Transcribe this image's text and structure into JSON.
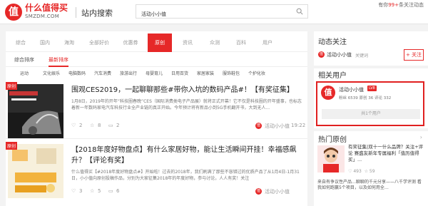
{
  "header": {
    "logo_char": "值",
    "brand": "什么值得买",
    "brand_sub": "SMZDM.COM",
    "search_title": "站内搜索",
    "search_value": "活动小小值",
    "follow_prefix": "有你",
    "follow_count": "99+",
    "follow_suffix": "条关注动态"
  },
  "tabs": [
    "综合",
    "国内",
    "海淘",
    "全部好价",
    "优惠券",
    "原创",
    "资讯",
    "众测",
    "百科",
    "用户"
  ],
  "active_tab": "原创",
  "sort": {
    "label": "综合排序",
    "active": "最新排序"
  },
  "sub_cats": [
    "运动",
    "文化娱乐",
    "电脑数码",
    "汽车消费",
    "旅游出行",
    "母婴育儿",
    "日用百货",
    "家居家装",
    "服饰鞋包",
    "个护化妆"
  ],
  "articles": [
    {
      "badge": "原创",
      "title": "围观CES2019，一起聊聊那些#带你入坑的数码产品#！【有奖征集】",
      "excerpt": "1月8日，2019年的开年“科技圈春晚”CES（国际消费类电子产品展）就将正式开幕！它不仅是科技圈的开年盛事，也标志着新一年数码家电汽车科技行业全产业链的真正开始。今年预计将有新品小到5G手机翻开书，大到无人...",
      "likes": "2",
      "fav": "8",
      "comments": "2",
      "author": "活动小小值",
      "time": "19:22"
    },
    {
      "badge": "原创",
      "title": "【2018年度好物盘点】有什么家居好物，能让生活瞬间开挂！幸福感飙升？【评论有奖】",
      "excerpt": "什么值得买【#2018年度好物盘点#】开始啦！过去的2018年，我们刷满了那些不容错过的优质产品了从1月4日-1月31日，小小值向原创投稿作品，分别为大家征集2018年的年度好物，参与讨论，人人有奖！关注",
      "likes": "3",
      "fav": "5",
      "comments": "6",
      "author": "活动小小值",
      "time": ""
    }
  ],
  "right": {
    "follow_title": "动态关注",
    "follow_user": "活动小小值",
    "follow_keyword": "关键词",
    "follow_btn": "+ 关注",
    "related_title": "相关用户",
    "user_name": "活动小小值",
    "user_level": "LV8",
    "user_stats": "粉丝 6539  原创 36  评论 332",
    "user_count": "共1个用户",
    "hot_title": "热门原创",
    "hot_item_title": "有奖征集|双十一什么品牌？关注+评论 赛盛友新年专属福利「值历值得买」...",
    "hot_likes": "493",
    "hot_fav": "59",
    "hot_item_ex": "来自有争议性产品…聊聊的千元分享——八千学评测 看我如何跑赢5个项目，以及如何用全…"
  }
}
